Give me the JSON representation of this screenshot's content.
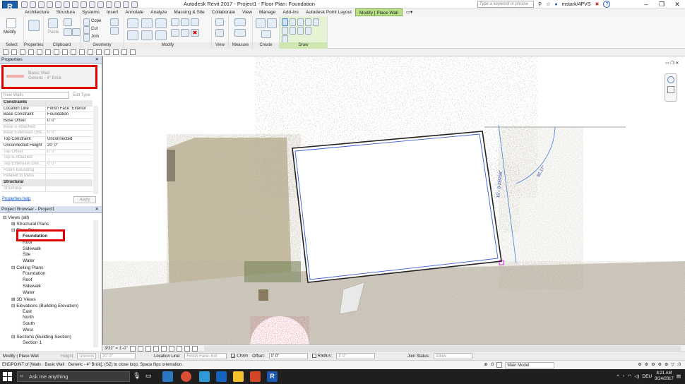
{
  "app": {
    "logo": "R",
    "window_title": "Autodesk Revit 2017 -   Project1 - Floor Plan: Foundation"
  },
  "title_bar": {
    "search_placeholder": "Type a keyword or phrase",
    "username": "mstark/4PVS",
    "help_label": "?"
  },
  "ribbon": {
    "tabs": [
      "Architecture",
      "Structure",
      "Systems",
      "Insert",
      "Annotate",
      "Analyze",
      "Massing & Site",
      "Collaborate",
      "View",
      "Manage",
      "Add-Ins",
      "Autodesk Point Layout",
      "Modify | Place Wall"
    ],
    "active_tab": "Modify | Place Wall",
    "panels": [
      "Select",
      "Properties",
      "Clipboard",
      "Geometry",
      "Modify",
      "View",
      "Measure",
      "Create",
      "Draw"
    ],
    "buttons": {
      "modify": "Modify",
      "paste": "Paste",
      "cope": "Cope",
      "cut": "Cut",
      "join": "Join"
    }
  },
  "properties": {
    "title": "Properties",
    "type_name": "Basic Wall",
    "type_sub": "Generic - 4\" Brick",
    "instance_filter": "New Walls",
    "edit_type": "Edit Type",
    "rows": [
      {
        "k": "Constraints",
        "v": "",
        "group": true
      },
      {
        "k": "Location Line",
        "v": "Finish Face: Exterior"
      },
      {
        "k": "Base Constraint",
        "v": "Foundation"
      },
      {
        "k": "Base Offset",
        "v": "0' 0\""
      },
      {
        "k": "Base is Attached",
        "v": "",
        "grey": true
      },
      {
        "k": "Base Extension Dist...",
        "v": "0' 0\"",
        "grey": true
      },
      {
        "k": "Top Constraint",
        "v": "Unconnected"
      },
      {
        "k": "Unconnected Height",
        "v": "20' 0\""
      },
      {
        "k": "Top Offset",
        "v": "0' 0\"",
        "grey": true
      },
      {
        "k": "Top is Attached",
        "v": "",
        "grey": true
      },
      {
        "k": "Top Extension Dist...",
        "v": "0' 0\"",
        "grey": true
      },
      {
        "k": "Room Bounding",
        "v": "",
        "grey": true
      },
      {
        "k": "Related to Mass",
        "v": "",
        "grey": true
      },
      {
        "k": "Structural",
        "v": "",
        "group": true
      },
      {
        "k": "Structural",
        "v": "",
        "grey": true
      }
    ],
    "help_link": "Properties help",
    "apply": "Apply"
  },
  "browser": {
    "title": "Project Browser - Project1",
    "items": [
      {
        "label": "Views (all)",
        "indent": 0,
        "exp": "⊟"
      },
      {
        "label": "Structural Plans",
        "indent": 1,
        "exp": "⊞"
      },
      {
        "label": "Floor Plans",
        "indent": 1,
        "exp": "⊟"
      },
      {
        "label": "Foundation",
        "indent": 2,
        "bold": true
      },
      {
        "label": "Roof",
        "indent": 2
      },
      {
        "label": "Sidewalk",
        "indent": 2
      },
      {
        "label": "Site",
        "indent": 2
      },
      {
        "label": "Water",
        "indent": 2
      },
      {
        "label": "Ceiling Plans",
        "indent": 1,
        "exp": "⊟"
      },
      {
        "label": "Foundation",
        "indent": 2
      },
      {
        "label": "Roof",
        "indent": 2
      },
      {
        "label": "Sidewalk",
        "indent": 2
      },
      {
        "label": "Water",
        "indent": 2
      },
      {
        "label": "3D Views",
        "indent": 1,
        "exp": "⊞"
      },
      {
        "label": "Elevations (Building Elevation)",
        "indent": 1,
        "exp": "⊟"
      },
      {
        "label": "East",
        "indent": 2
      },
      {
        "label": "North",
        "indent": 2
      },
      {
        "label": "South",
        "indent": 2
      },
      {
        "label": "West",
        "indent": 2
      },
      {
        "label": "Sections (Building Section)",
        "indent": 1,
        "exp": "⊟"
      },
      {
        "label": "Section 1",
        "indent": 2
      }
    ]
  },
  "canvas": {
    "dimension_label": "15' - 8 29/256\"",
    "angle_label": "82.17°"
  },
  "view_bar": {
    "scale": "3/32\" = 1'-0\""
  },
  "options_bar": {
    "mode": "Modify | Place Wall",
    "height_label": "Height",
    "height_value": "Unconn",
    "height_num": "20' 0\"",
    "location_line_label": "Location Line:",
    "location_line_value": "Finish Face: Ext",
    "chain_label": "Chain",
    "offset_label": "Offset:",
    "offset_value": "0' 0\"",
    "radius_label": "Radius:",
    "radius_value": "1' 0\"",
    "join_status_label": "Join Status:",
    "join_status_value": "Allow"
  },
  "status_bar": {
    "message": "ENDPOINT  of [Walls : Basic Wall : Generic - 4\" Brick]. (SZ) to close loop. Space flips orientation.",
    "counter": ":0",
    "model": "Main Model",
    "filter": ":0"
  },
  "taskbar": {
    "search_placeholder": "Ask me anything",
    "lang": "DEU",
    "time": "8:21 AM",
    "date": "3/24/2017"
  }
}
